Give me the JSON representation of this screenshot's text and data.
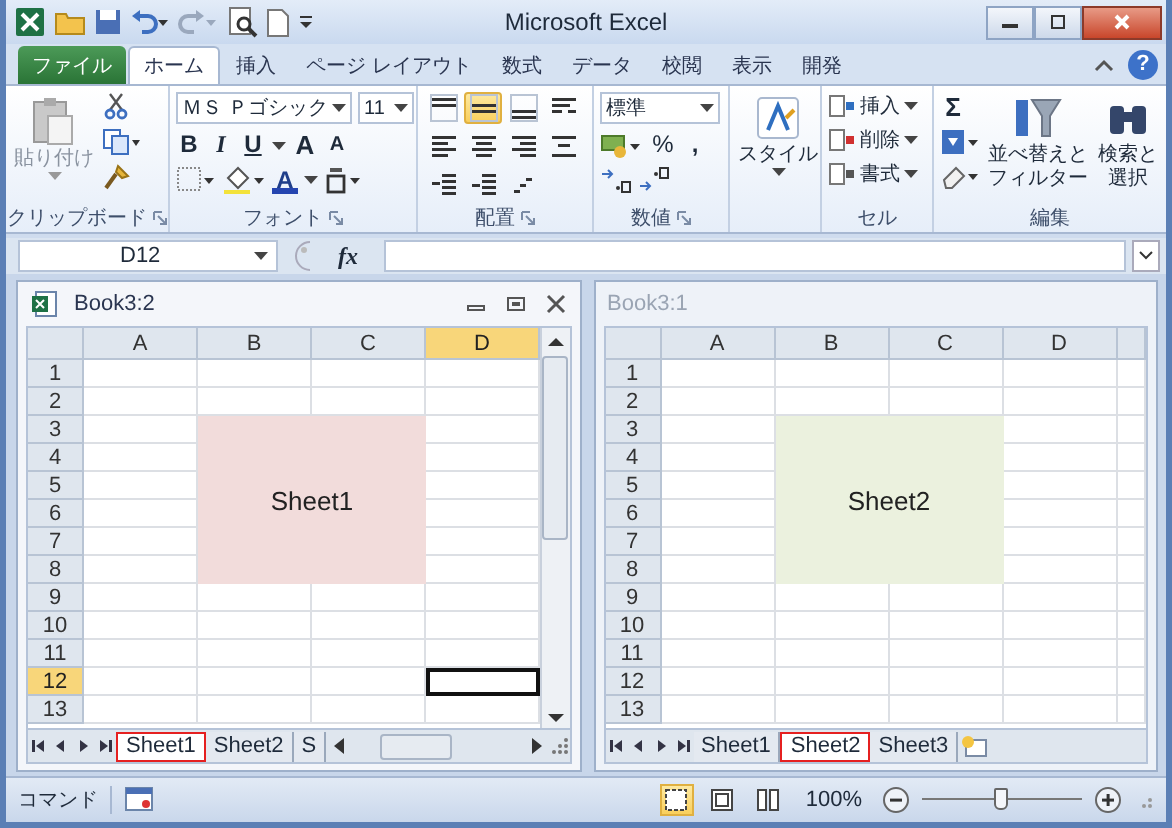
{
  "title_bar": {
    "title": "Microsoft Excel"
  },
  "ribbon_tabs": [
    {
      "label": "ファイル",
      "kind": "file",
      "selected": false
    },
    {
      "label": "ホーム",
      "kind": "tab",
      "selected": true
    },
    {
      "label": "挿入",
      "kind": "tab",
      "selected": false
    },
    {
      "label": "ページ レイアウト",
      "kind": "tab",
      "selected": false
    },
    {
      "label": "数式",
      "kind": "tab",
      "selected": false
    },
    {
      "label": "データ",
      "kind": "tab",
      "selected": false
    },
    {
      "label": "校閲",
      "kind": "tab",
      "selected": false
    },
    {
      "label": "表示",
      "kind": "tab",
      "selected": false
    },
    {
      "label": "開発",
      "kind": "tab",
      "selected": false
    }
  ],
  "help": "?",
  "clipboard": {
    "label": "クリップボード",
    "paste": "貼り付け"
  },
  "font": {
    "label": "フォント",
    "name": "ＭＳ Ｐゴシック",
    "size": "11",
    "bold": "B",
    "italic": "I",
    "underline": "U",
    "grow": "A",
    "shrink": "A",
    "font_color": "A"
  },
  "alignment": {
    "label": "配置",
    "rows": [
      [
        {
          "kind": "top",
          "selected": false
        },
        {
          "kind": "middle",
          "selected": true
        },
        {
          "kind": "bottom",
          "selected": false
        },
        {
          "kind": "wrap",
          "selected": false
        }
      ],
      [
        {
          "kind": "left",
          "selected": false
        },
        {
          "kind": "center",
          "selected": false
        },
        {
          "kind": "right",
          "selected": false
        },
        {
          "kind": "merge",
          "selected": false
        }
      ],
      [
        {
          "kind": "outdent",
          "selected": false
        },
        {
          "kind": "indent",
          "selected": false
        },
        {
          "kind": "orient",
          "selected": false
        }
      ]
    ]
  },
  "number": {
    "label": "数値",
    "format": "標準",
    "percent": "%",
    "comma": ","
  },
  "styles": {
    "button": "スタイル"
  },
  "cells": {
    "label": "セル",
    "buttons": [
      {
        "kind": "insert",
        "label": "挿入"
      },
      {
        "kind": "delete",
        "label": "削除"
      },
      {
        "kind": "format",
        "label": "書式"
      }
    ]
  },
  "editing": {
    "label": "編集",
    "sum": "Σ",
    "sort": [
      "並べ替えと",
      "フィルター"
    ],
    "find": [
      "検索と",
      "選択"
    ]
  },
  "formula_bar": {
    "name_box": "D12",
    "fx": "fx"
  },
  "windows": [
    {
      "title": "Book3:2",
      "active": true,
      "insert_sheet_tab": false,
      "columns": [
        {
          "label": "A",
          "selected": false
        },
        {
          "label": "B",
          "selected": false
        },
        {
          "label": "C",
          "selected": false
        },
        {
          "label": "D",
          "selected": true
        }
      ],
      "rows": [
        {
          "label": "1",
          "selected": false
        },
        {
          "label": "2",
          "selected": false
        },
        {
          "label": "3",
          "selected": false
        },
        {
          "label": "4",
          "selected": false
        },
        {
          "label": "5",
          "selected": false
        },
        {
          "label": "6",
          "selected": false
        },
        {
          "label": "7",
          "selected": false
        },
        {
          "label": "8",
          "selected": false
        },
        {
          "label": "9",
          "selected": false
        },
        {
          "label": "10",
          "selected": false
        },
        {
          "label": "11",
          "selected": false
        },
        {
          "label": "12",
          "selected": true
        },
        {
          "label": "13",
          "selected": false
        }
      ],
      "block": {
        "text": "Sheet1",
        "color": "#f2dcdb"
      },
      "sheet_tabs": [
        {
          "label": "Sheet1",
          "selected": true
        },
        {
          "label": "Sheet2",
          "selected": false
        },
        {
          "label": "S",
          "selected": false
        }
      ]
    },
    {
      "title": "Book3:1",
      "active": false,
      "insert_sheet_tab": true,
      "columns": [
        {
          "label": "A",
          "selected": false
        },
        {
          "label": "B",
          "selected": false
        },
        {
          "label": "C",
          "selected": false
        },
        {
          "label": "D",
          "selected": false
        }
      ],
      "rows": [
        {
          "label": "1",
          "selected": false
        },
        {
          "label": "2",
          "selected": false
        },
        {
          "label": "3",
          "selected": false
        },
        {
          "label": "4",
          "selected": false
        },
        {
          "label": "5",
          "selected": false
        },
        {
          "label": "6",
          "selected": false
        },
        {
          "label": "7",
          "selected": false
        },
        {
          "label": "8",
          "selected": false
        },
        {
          "label": "9",
          "selected": false
        },
        {
          "label": "10",
          "selected": false
        },
        {
          "label": "11",
          "selected": false
        },
        {
          "label": "12",
          "selected": false
        },
        {
          "label": "13",
          "selected": false
        }
      ],
      "block": {
        "text": "Sheet2",
        "color": "#ebf1de"
      },
      "sheet_tabs": [
        {
          "label": "Sheet1",
          "selected": false
        },
        {
          "label": "Sheet2",
          "selected": true
        },
        {
          "label": "Sheet3",
          "selected": false
        }
      ]
    }
  ],
  "status_bar": {
    "mode": "コマンド",
    "views": [
      {
        "kind": "normal",
        "selected": true
      },
      {
        "kind": "page_layout",
        "selected": false
      },
      {
        "kind": "page_break",
        "selected": false
      }
    ],
    "zoom": "100%",
    "zoom_slider": {
      "level": 0.5
    }
  }
}
